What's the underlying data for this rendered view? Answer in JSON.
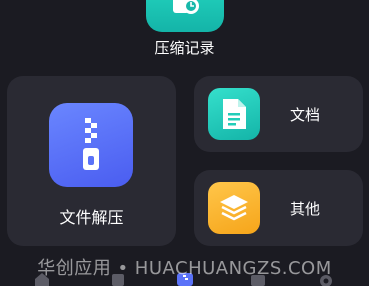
{
  "top_tile": {
    "label": "压缩记录",
    "icon": "compress-record-icon"
  },
  "cards": {
    "unzip": {
      "label": "文件解压",
      "icon": "zip-file-icon",
      "color": "#5a72f8"
    },
    "doc": {
      "label": "文档",
      "icon": "document-icon",
      "color": "#22cdb9"
    },
    "other": {
      "label": "其他",
      "icon": "layers-icon",
      "color": "#f9b32c"
    }
  },
  "watermark": "华创应用 • HUACHUANGZS.COM",
  "colors": {
    "background": "#1b1b22",
    "card": "#2a2a33"
  }
}
